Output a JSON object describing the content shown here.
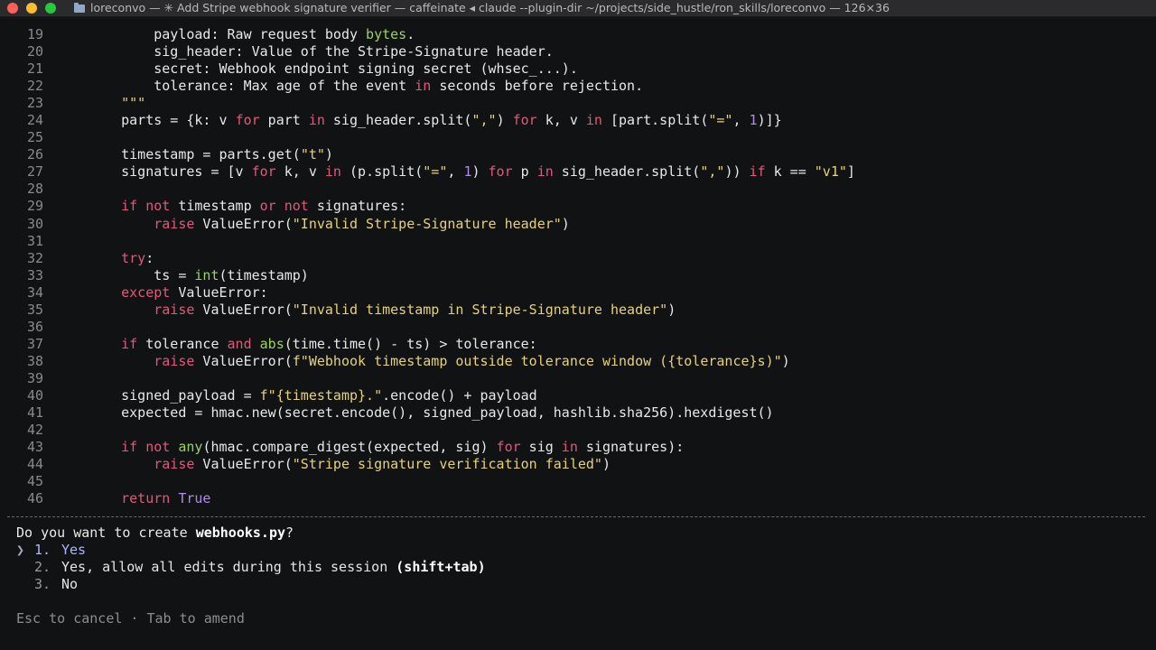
{
  "window": {
    "title": "loreconvo — ✳ Add Stripe webhook signature verifier — caffeinate ◂ claude --plugin-dir ~/projects/side_hustle/ron_skills/loreconvo — 126×36"
  },
  "code_lines": [
    {
      "n": "19",
      "tokens": [
        {
          "t": "        payload: Raw request body "
        },
        {
          "t": "bytes",
          "c": "bi"
        },
        {
          "t": "."
        }
      ]
    },
    {
      "n": "20",
      "tokens": [
        {
          "t": "        sig_header: Value of the Stripe-Signature header."
        }
      ]
    },
    {
      "n": "21",
      "tokens": [
        {
          "t": "        secret: Webhook endpoint signing secret (whsec_...)."
        }
      ]
    },
    {
      "n": "22",
      "tokens": [
        {
          "t": "        tolerance: Max age of the event "
        },
        {
          "t": "in",
          "c": "kw"
        },
        {
          "t": " seconds before rejection."
        }
      ]
    },
    {
      "n": "23",
      "tokens": [
        {
          "t": "    \"\"\"",
          "c": "str"
        }
      ]
    },
    {
      "n": "24",
      "tokens": [
        {
          "t": "    parts = {k: v "
        },
        {
          "t": "for",
          "c": "kw"
        },
        {
          "t": " part "
        },
        {
          "t": "in",
          "c": "kw"
        },
        {
          "t": " sig_header.split("
        },
        {
          "t": "\",\"",
          "c": "str"
        },
        {
          "t": ") "
        },
        {
          "t": "for",
          "c": "kw"
        },
        {
          "t": " k, v "
        },
        {
          "t": "in",
          "c": "kw"
        },
        {
          "t": " [part.split("
        },
        {
          "t": "\"=\"",
          "c": "str"
        },
        {
          "t": ", "
        },
        {
          "t": "1",
          "c": "num"
        },
        {
          "t": ")]}"
        }
      ]
    },
    {
      "n": "25",
      "tokens": [
        {
          "t": ""
        }
      ]
    },
    {
      "n": "26",
      "tokens": [
        {
          "t": "    timestamp = parts.get("
        },
        {
          "t": "\"t\"",
          "c": "str"
        },
        {
          "t": ")"
        }
      ]
    },
    {
      "n": "27",
      "tokens": [
        {
          "t": "    signatures = [v "
        },
        {
          "t": "for",
          "c": "kw"
        },
        {
          "t": " k, v "
        },
        {
          "t": "in",
          "c": "kw"
        },
        {
          "t": " (p.split("
        },
        {
          "t": "\"=\"",
          "c": "str"
        },
        {
          "t": ", "
        },
        {
          "t": "1",
          "c": "num"
        },
        {
          "t": ") "
        },
        {
          "t": "for",
          "c": "kw"
        },
        {
          "t": " p "
        },
        {
          "t": "in",
          "c": "kw"
        },
        {
          "t": " sig_header.split("
        },
        {
          "t": "\",\"",
          "c": "str"
        },
        {
          "t": ")) "
        },
        {
          "t": "if",
          "c": "kw"
        },
        {
          "t": " k == "
        },
        {
          "t": "\"v1\"",
          "c": "str"
        },
        {
          "t": "]"
        }
      ]
    },
    {
      "n": "28",
      "tokens": [
        {
          "t": ""
        }
      ]
    },
    {
      "n": "29",
      "tokens": [
        {
          "t": "    "
        },
        {
          "t": "if",
          "c": "kw"
        },
        {
          "t": " "
        },
        {
          "t": "not",
          "c": "kw"
        },
        {
          "t": " timestamp "
        },
        {
          "t": "or",
          "c": "kw"
        },
        {
          "t": " "
        },
        {
          "t": "not",
          "c": "kw"
        },
        {
          "t": " signatures:"
        }
      ]
    },
    {
      "n": "30",
      "tokens": [
        {
          "t": "        "
        },
        {
          "t": "raise",
          "c": "kw"
        },
        {
          "t": " ValueError("
        },
        {
          "t": "\"Invalid Stripe-Signature header\"",
          "c": "str"
        },
        {
          "t": ")"
        }
      ]
    },
    {
      "n": "31",
      "tokens": [
        {
          "t": ""
        }
      ]
    },
    {
      "n": "32",
      "tokens": [
        {
          "t": "    "
        },
        {
          "t": "try",
          "c": "kw"
        },
        {
          "t": ":"
        }
      ]
    },
    {
      "n": "33",
      "tokens": [
        {
          "t": "        ts = "
        },
        {
          "t": "int",
          "c": "bi"
        },
        {
          "t": "(timestamp)"
        }
      ]
    },
    {
      "n": "34",
      "tokens": [
        {
          "t": "    "
        },
        {
          "t": "except",
          "c": "kw"
        },
        {
          "t": " ValueError:"
        }
      ]
    },
    {
      "n": "35",
      "tokens": [
        {
          "t": "        "
        },
        {
          "t": "raise",
          "c": "kw"
        },
        {
          "t": " ValueError("
        },
        {
          "t": "\"Invalid timestamp in Stripe-Signature header\"",
          "c": "str"
        },
        {
          "t": ")"
        }
      ]
    },
    {
      "n": "36",
      "tokens": [
        {
          "t": ""
        }
      ]
    },
    {
      "n": "37",
      "tokens": [
        {
          "t": "    "
        },
        {
          "t": "if",
          "c": "kw"
        },
        {
          "t": " tolerance "
        },
        {
          "t": "and",
          "c": "kw"
        },
        {
          "t": " "
        },
        {
          "t": "abs",
          "c": "bi"
        },
        {
          "t": "(time.time() - ts) > tolerance:"
        }
      ]
    },
    {
      "n": "38",
      "tokens": [
        {
          "t": "        "
        },
        {
          "t": "raise",
          "c": "kw"
        },
        {
          "t": " ValueError("
        },
        {
          "t": "f\"Webhook timestamp outside tolerance window ({tolerance}s)\"",
          "c": "str"
        },
        {
          "t": ")"
        }
      ]
    },
    {
      "n": "39",
      "tokens": [
        {
          "t": ""
        }
      ]
    },
    {
      "n": "40",
      "tokens": [
        {
          "t": "    signed_payload = "
        },
        {
          "t": "f\"{timestamp}.\"",
          "c": "str"
        },
        {
          "t": ".encode() + payload"
        }
      ]
    },
    {
      "n": "41",
      "tokens": [
        {
          "t": "    expected = hmac.new(secret.encode(), signed_payload, hashlib.sha256).hexdigest()"
        }
      ]
    },
    {
      "n": "42",
      "tokens": [
        {
          "t": ""
        }
      ]
    },
    {
      "n": "43",
      "tokens": [
        {
          "t": "    "
        },
        {
          "t": "if",
          "c": "kw"
        },
        {
          "t": " "
        },
        {
          "t": "not",
          "c": "kw"
        },
        {
          "t": " "
        },
        {
          "t": "any",
          "c": "bi"
        },
        {
          "t": "(hmac.compare_digest(expected, sig) "
        },
        {
          "t": "for",
          "c": "kw"
        },
        {
          "t": " sig "
        },
        {
          "t": "in",
          "c": "kw"
        },
        {
          "t": " signatures):"
        }
      ]
    },
    {
      "n": "44",
      "tokens": [
        {
          "t": "        "
        },
        {
          "t": "raise",
          "c": "kw"
        },
        {
          "t": " ValueError("
        },
        {
          "t": "\"Stripe signature verification failed\"",
          "c": "str"
        },
        {
          "t": ")"
        }
      ]
    },
    {
      "n": "45",
      "tokens": [
        {
          "t": ""
        }
      ]
    },
    {
      "n": "46",
      "tokens": [
        {
          "t": "    "
        },
        {
          "t": "return",
          "c": "kw"
        },
        {
          "t": " "
        },
        {
          "t": "True",
          "c": "pill"
        }
      ]
    }
  ],
  "prompt": {
    "question_prefix": "Do you want to create ",
    "question_file": "webhooks.py",
    "question_suffix": "?",
    "cursor": "❯",
    "options": [
      {
        "num": "1.",
        "label": "Yes",
        "bold": ""
      },
      {
        "num": "2.",
        "label": "Yes, allow all edits during this session ",
        "bold": "(shift+tab)"
      },
      {
        "num": "3.",
        "label": "No",
        "bold": ""
      }
    ],
    "selected_index": 0
  },
  "footer": "Esc to cancel · Tab to amend",
  "colors": {
    "keyword": "#e0597a",
    "string": "#e6d278",
    "number": "#b18ce6",
    "builtin": "#9ad35a",
    "selected": "#aeb4ff"
  }
}
